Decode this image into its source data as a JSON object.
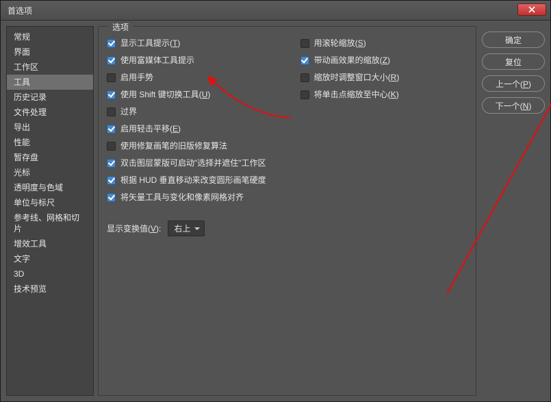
{
  "window": {
    "title": "首选项"
  },
  "sidebar": {
    "items": [
      {
        "label": "常规"
      },
      {
        "label": "界面"
      },
      {
        "label": "工作区"
      },
      {
        "label": "工具",
        "active": true
      },
      {
        "label": "历史记录"
      },
      {
        "label": "文件处理"
      },
      {
        "label": "导出"
      },
      {
        "label": "性能"
      },
      {
        "label": "暂存盘"
      },
      {
        "label": "光标"
      },
      {
        "label": "透明度与色域"
      },
      {
        "label": "单位与标尺"
      },
      {
        "label": "参考线、网格和切片"
      },
      {
        "label": "增效工具"
      },
      {
        "label": "文字"
      },
      {
        "label": "3D"
      },
      {
        "label": "技术预览"
      }
    ]
  },
  "options": {
    "legend": "选项",
    "left": [
      {
        "label": "显示工具提示",
        "key": "T",
        "checked": true
      },
      {
        "label": "使用富媒体工具提示",
        "key": "",
        "checked": true
      },
      {
        "label": "启用手势",
        "key": "",
        "checked": false
      },
      {
        "label": "使用 Shift 键切换工具",
        "key": "U",
        "checked": true
      },
      {
        "label": "过界",
        "key": "",
        "checked": false
      },
      {
        "label": "启用轻击平移",
        "key": "E",
        "checked": true
      },
      {
        "label": "使用修复画笔的旧版修复算法",
        "key": "",
        "checked": false
      },
      {
        "label": "双击图层蒙版可启动\"选择并遮住\"工作区",
        "key": "",
        "checked": true
      },
      {
        "label": "根据 HUD 垂直移动来改变圆形画笔硬度",
        "key": "",
        "checked": true
      },
      {
        "label": "将矢量工具与变化和像素网格对齐",
        "key": "",
        "checked": true
      }
    ],
    "right": [
      {
        "label": "用滚轮缩放",
        "key": "S",
        "checked": false
      },
      {
        "label": "带动画效果的缩放",
        "key": "Z",
        "checked": true
      },
      {
        "label": "缩放时调整窗口大小",
        "key": "R",
        "checked": false
      },
      {
        "label": "将单击点缩放至中心",
        "key": "K",
        "checked": false
      }
    ],
    "transform_label": "显示变换值",
    "transform_key": "V",
    "transform_value": "右上"
  },
  "buttons": {
    "ok": "确定",
    "reset": "复位",
    "prev_label": "上一个",
    "prev_key": "P",
    "next_label": "下一个",
    "next_key": "N"
  }
}
